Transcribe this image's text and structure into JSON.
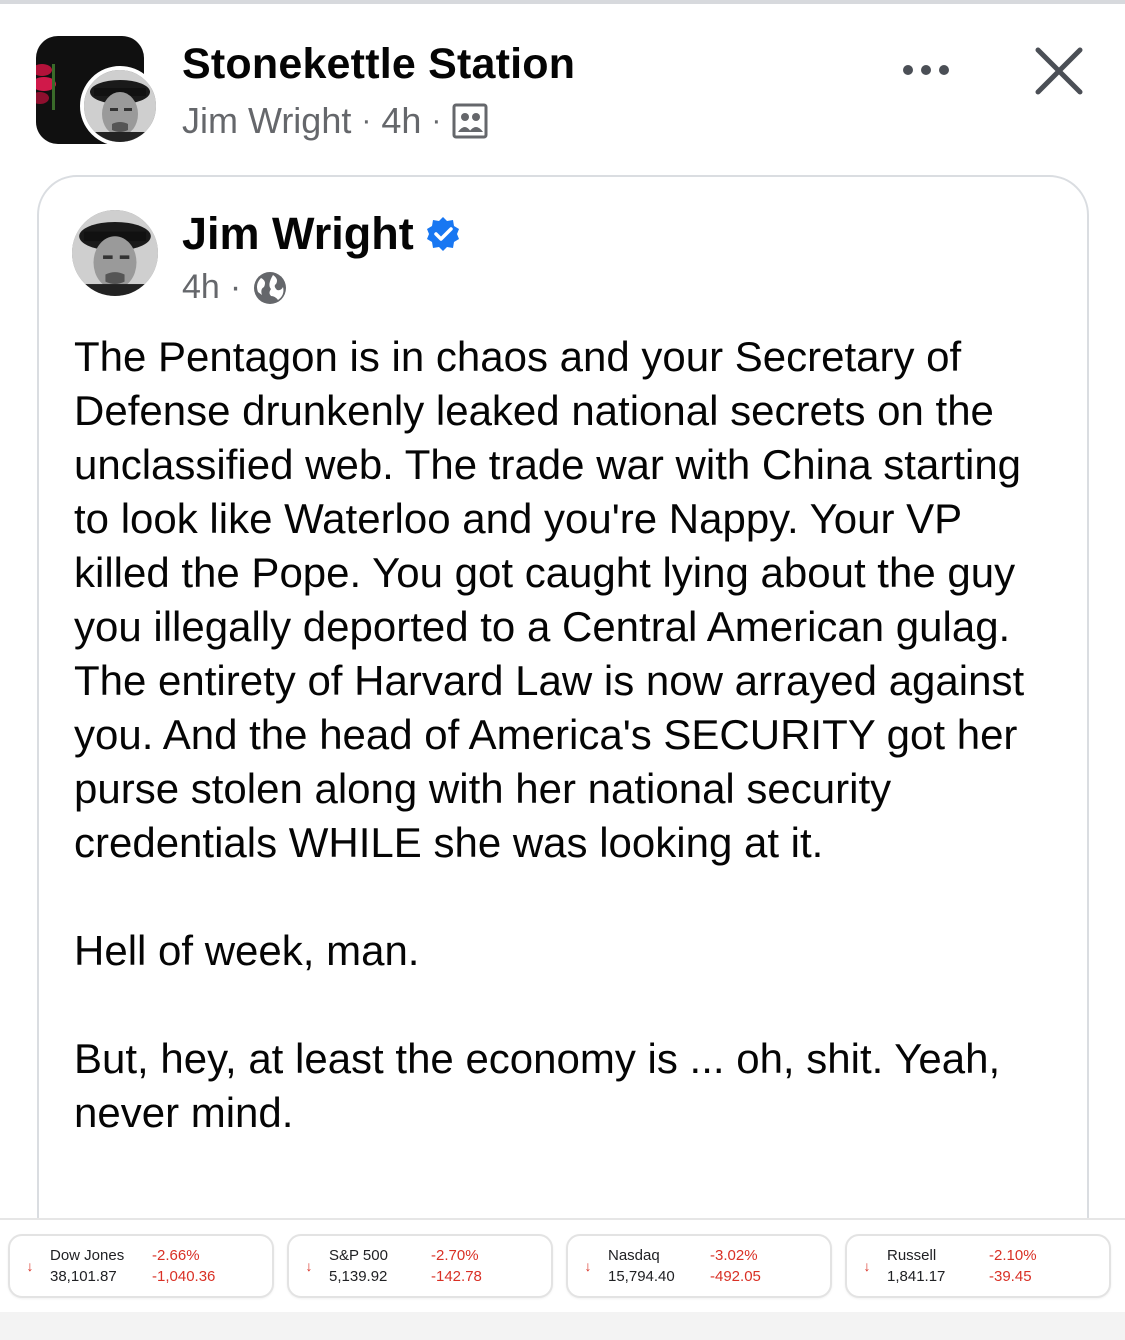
{
  "header": {
    "group_name": "Stonekettle Station",
    "author": "Jim Wright",
    "separator": "·",
    "time": "4h",
    "icons": [
      "more-icon",
      "close-icon",
      "group-photo-icon"
    ]
  },
  "shared_post": {
    "author": "Jim Wright",
    "time": "4h",
    "separator": "·",
    "verified_color": "#1877f2",
    "icons": [
      "verified-badge-icon",
      "globe-icon"
    ],
    "paragraphs": [
      "The Pentagon is in chaos and your Secretary of Defense drunkenly leaked national secrets on the unclassified web. The trade war with China starting to look like Waterloo and you're Nappy. Your VP killed the Pope. You got caught lying about the guy you illegally deported to a Central American gulag. The entirety of Harvard Law is now arrayed against you. And the head of America's SECURITY got her purse stolen along with her national security credentials WHILE she was looking at it.",
      "Hell of week, man.",
      "But, hey, at least the economy is ... oh, shit. Yeah, never mind."
    ]
  },
  "tickers": [
    {
      "name": "Dow Jones",
      "value": "38,101.87",
      "pct": "-2.66%",
      "change": "-1,040.36"
    },
    {
      "name": "S&P 500",
      "value": "5,139.92",
      "pct": "-2.70%",
      "change": "-142.78"
    },
    {
      "name": "Nasdaq",
      "value": "15,794.40",
      "pct": "-3.02%",
      "change": "-492.05"
    },
    {
      "name": "Russell",
      "value": "1,841.17",
      "pct": "-2.10%",
      "change": "-39.45"
    }
  ],
  "colors": {
    "negative": "#d93025",
    "meta_text": "#65676b",
    "card_border": "#dadde1"
  }
}
